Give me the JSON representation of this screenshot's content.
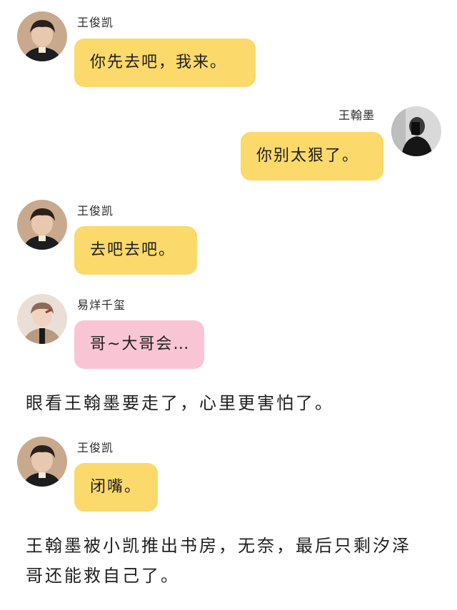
{
  "messages": [
    {
      "sender": "王俊凯",
      "text": "你先去吧，我来。",
      "side": "left",
      "bubble_color": "#fbd96a",
      "avatar": "boy-avatar-dark-hair"
    },
    {
      "sender": "王翰墨",
      "text": "你别太狠了。",
      "side": "right",
      "bubble_color": "#fbd96a",
      "avatar": "boy-avatar-mirror-selfie"
    },
    {
      "sender": "王俊凯",
      "text": "去吧去吧。",
      "side": "left",
      "bubble_color": "#fbd96a",
      "avatar": "boy-avatar-dark-hair"
    },
    {
      "sender": "易烊千玺",
      "text": "哥~大哥会…",
      "side": "left",
      "bubble_color": "#f9c5d4",
      "avatar": "boy-avatar-light"
    }
  ],
  "narration_1": "眼看王翰墨要走了，心里更害怕了。",
  "message_5": {
    "sender": "王俊凯",
    "text": "闭嘴。",
    "side": "left",
    "bubble_color": "#fbd96a",
    "avatar": "boy-avatar-dark-hair"
  },
  "narration_2": "王翰墨被小凯推出书房，无奈，最后只剩汐泽哥还能救自己了。"
}
